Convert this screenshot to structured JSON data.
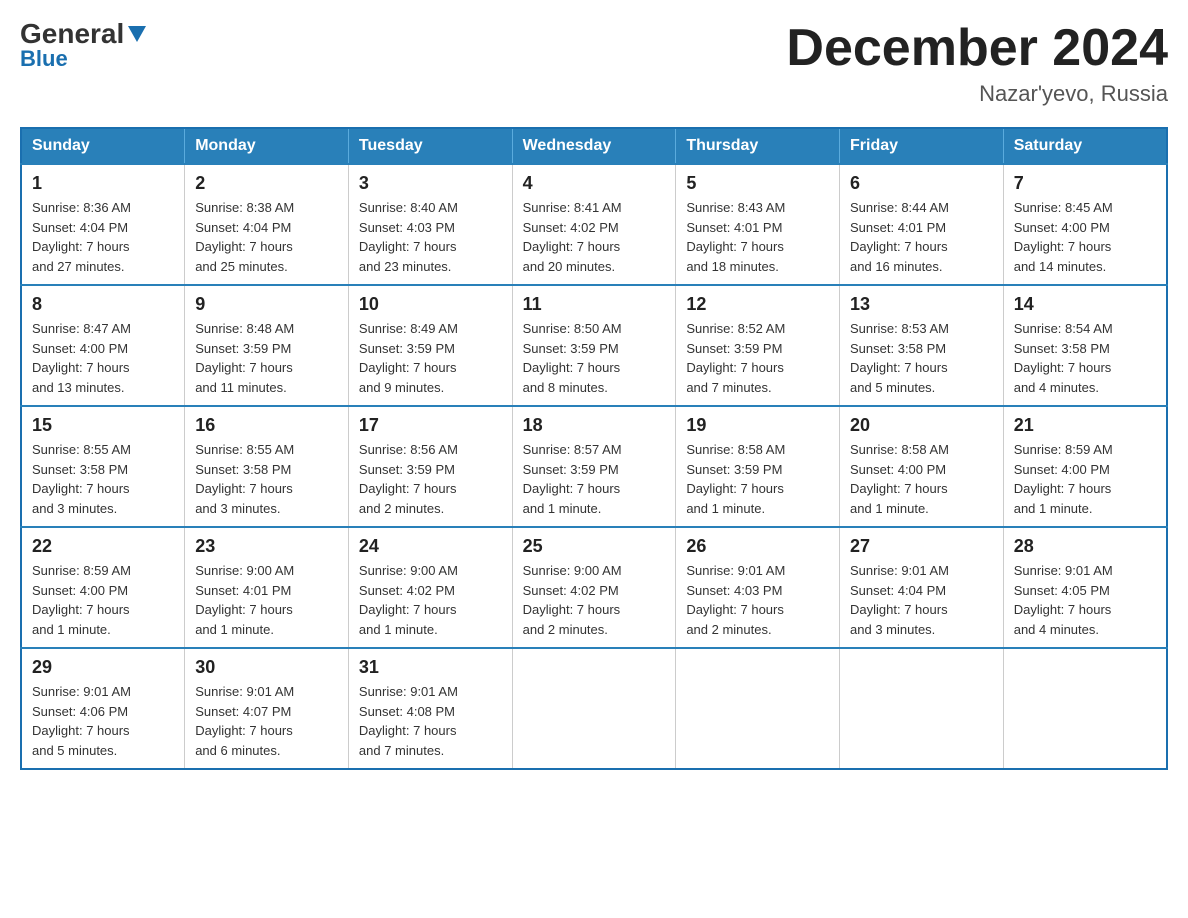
{
  "header": {
    "logo_general": "General",
    "logo_blue": "Blue",
    "month_title": "December 2024",
    "location": "Nazar'yevo, Russia"
  },
  "days_of_week": [
    "Sunday",
    "Monday",
    "Tuesday",
    "Wednesday",
    "Thursday",
    "Friday",
    "Saturday"
  ],
  "weeks": [
    [
      {
        "day": "1",
        "sunrise": "8:36 AM",
        "sunset": "4:04 PM",
        "daylight": "7 hours and 27 minutes."
      },
      {
        "day": "2",
        "sunrise": "8:38 AM",
        "sunset": "4:04 PM",
        "daylight": "7 hours and 25 minutes."
      },
      {
        "day": "3",
        "sunrise": "8:40 AM",
        "sunset": "4:03 PM",
        "daylight": "7 hours and 23 minutes."
      },
      {
        "day": "4",
        "sunrise": "8:41 AM",
        "sunset": "4:02 PM",
        "daylight": "7 hours and 20 minutes."
      },
      {
        "day": "5",
        "sunrise": "8:43 AM",
        "sunset": "4:01 PM",
        "daylight": "7 hours and 18 minutes."
      },
      {
        "day": "6",
        "sunrise": "8:44 AM",
        "sunset": "4:01 PM",
        "daylight": "7 hours and 16 minutes."
      },
      {
        "day": "7",
        "sunrise": "8:45 AM",
        "sunset": "4:00 PM",
        "daylight": "7 hours and 14 minutes."
      }
    ],
    [
      {
        "day": "8",
        "sunrise": "8:47 AM",
        "sunset": "4:00 PM",
        "daylight": "7 hours and 13 minutes."
      },
      {
        "day": "9",
        "sunrise": "8:48 AM",
        "sunset": "3:59 PM",
        "daylight": "7 hours and 11 minutes."
      },
      {
        "day": "10",
        "sunrise": "8:49 AM",
        "sunset": "3:59 PM",
        "daylight": "7 hours and 9 minutes."
      },
      {
        "day": "11",
        "sunrise": "8:50 AM",
        "sunset": "3:59 PM",
        "daylight": "7 hours and 8 minutes."
      },
      {
        "day": "12",
        "sunrise": "8:52 AM",
        "sunset": "3:59 PM",
        "daylight": "7 hours and 7 minutes."
      },
      {
        "day": "13",
        "sunrise": "8:53 AM",
        "sunset": "3:58 PM",
        "daylight": "7 hours and 5 minutes."
      },
      {
        "day": "14",
        "sunrise": "8:54 AM",
        "sunset": "3:58 PM",
        "daylight": "7 hours and 4 minutes."
      }
    ],
    [
      {
        "day": "15",
        "sunrise": "8:55 AM",
        "sunset": "3:58 PM",
        "daylight": "7 hours and 3 minutes."
      },
      {
        "day": "16",
        "sunrise": "8:55 AM",
        "sunset": "3:58 PM",
        "daylight": "7 hours and 3 minutes."
      },
      {
        "day": "17",
        "sunrise": "8:56 AM",
        "sunset": "3:59 PM",
        "daylight": "7 hours and 2 minutes."
      },
      {
        "day": "18",
        "sunrise": "8:57 AM",
        "sunset": "3:59 PM",
        "daylight": "7 hours and 1 minute."
      },
      {
        "day": "19",
        "sunrise": "8:58 AM",
        "sunset": "3:59 PM",
        "daylight": "7 hours and 1 minute."
      },
      {
        "day": "20",
        "sunrise": "8:58 AM",
        "sunset": "4:00 PM",
        "daylight": "7 hours and 1 minute."
      },
      {
        "day": "21",
        "sunrise": "8:59 AM",
        "sunset": "4:00 PM",
        "daylight": "7 hours and 1 minute."
      }
    ],
    [
      {
        "day": "22",
        "sunrise": "8:59 AM",
        "sunset": "4:00 PM",
        "daylight": "7 hours and 1 minute."
      },
      {
        "day": "23",
        "sunrise": "9:00 AM",
        "sunset": "4:01 PM",
        "daylight": "7 hours and 1 minute."
      },
      {
        "day": "24",
        "sunrise": "9:00 AM",
        "sunset": "4:02 PM",
        "daylight": "7 hours and 1 minute."
      },
      {
        "day": "25",
        "sunrise": "9:00 AM",
        "sunset": "4:02 PM",
        "daylight": "7 hours and 2 minutes."
      },
      {
        "day": "26",
        "sunrise": "9:01 AM",
        "sunset": "4:03 PM",
        "daylight": "7 hours and 2 minutes."
      },
      {
        "day": "27",
        "sunrise": "9:01 AM",
        "sunset": "4:04 PM",
        "daylight": "7 hours and 3 minutes."
      },
      {
        "day": "28",
        "sunrise": "9:01 AM",
        "sunset": "4:05 PM",
        "daylight": "7 hours and 4 minutes."
      }
    ],
    [
      {
        "day": "29",
        "sunrise": "9:01 AM",
        "sunset": "4:06 PM",
        "daylight": "7 hours and 5 minutes."
      },
      {
        "day": "30",
        "sunrise": "9:01 AM",
        "sunset": "4:07 PM",
        "daylight": "7 hours and 6 minutes."
      },
      {
        "day": "31",
        "sunrise": "9:01 AM",
        "sunset": "4:08 PM",
        "daylight": "7 hours and 7 minutes."
      },
      null,
      null,
      null,
      null
    ]
  ],
  "labels": {
    "sunrise": "Sunrise:",
    "sunset": "Sunset:",
    "daylight": "Daylight:"
  }
}
